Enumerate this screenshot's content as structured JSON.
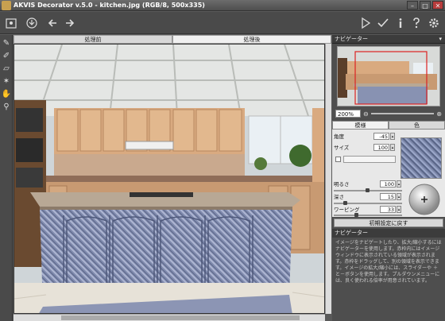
{
  "window": {
    "title": "AKVIS Decorator v.5.0 - kitchen.jpg (RGB/8, 500x335)"
  },
  "toolbar": {
    "icons": [
      "open-icon",
      "save-icon",
      "undo-icon",
      "redo-icon"
    ],
    "right_icons": [
      "run-icon",
      "apply-icon",
      "info-icon",
      "help-icon",
      "settings-icon"
    ]
  },
  "tabs": {
    "before": "処理前",
    "after": "処理後"
  },
  "panel": {
    "navigator_title": "ナビゲーター",
    "zoom": "200%",
    "tab_pattern": "模様",
    "tab_color": "色",
    "angle_label": "角度",
    "angle_value": "-45",
    "size_label": "サイズ",
    "size_value": "100",
    "brightness_label": "明るさ",
    "brightness_value": "100",
    "depth_label": "深さ",
    "depth_value": "15",
    "warping_label": "ワーピング",
    "warping_value": "33",
    "reset_label": "初期設定に戻す",
    "help_title": "ナビゲーター",
    "help_text": "イメージをナビゲートしたり、拡大/縮小するにはナビゲーターを使用します。赤枠内にはイメージ ウィンドウに表示されている領域が表示されます。赤枠をドラッグして、別の領域を表示できます。イメージの拡大/縮小には、スライダーや ＋ と－ボタンを使用します。プルダウンメニューには、良く使われる倍率が用意されています。"
  }
}
